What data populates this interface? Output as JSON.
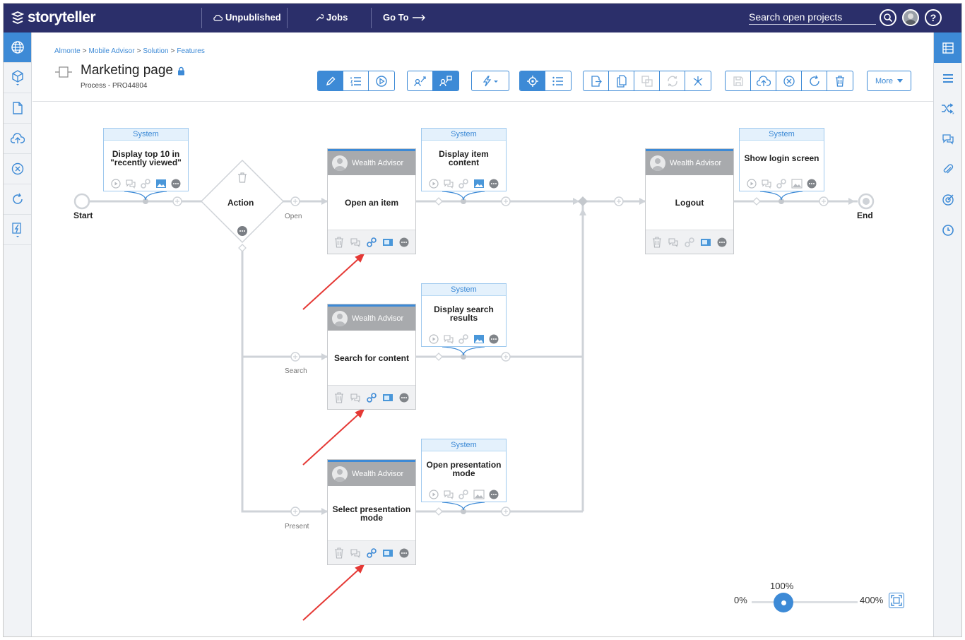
{
  "app": {
    "logo_text": "storyteller",
    "nav": {
      "unpublished": "Unpublished",
      "jobs": "Jobs",
      "goto": "Go To"
    },
    "search_placeholder": "Search open projects",
    "help": "?"
  },
  "breadcrumb": [
    "Almonte",
    "Mobile Advisor",
    "Solution",
    "Features"
  ],
  "breadcrumb_sep": ">",
  "page": {
    "title": "Marketing page",
    "subtitle": "Process - PRO44804"
  },
  "toolbar": {
    "more_label": "More"
  },
  "diagram": {
    "start": "Start",
    "end": "End",
    "action": "Action",
    "branch_labels": {
      "open": "Open",
      "search": "Search",
      "present": "Present"
    },
    "system_label": "System",
    "role_label": "Wealth Advisor",
    "system_steps": {
      "s1": "Display top 10 in \"recently viewed\"",
      "s2": "Display item content",
      "s3": "Show login screen",
      "s4": "Display search results",
      "s5": "Open presentation mode"
    },
    "user_steps": {
      "u1": "Open an item",
      "u2": "Logout",
      "u3": "Search for content",
      "u4": "Select presentation mode"
    },
    "highlight_color": "#3d8ad6",
    "arrow_color": "#e53935"
  },
  "zoom": {
    "min": "0%",
    "current": "100%",
    "max": "400%",
    "value_percent": 100
  }
}
